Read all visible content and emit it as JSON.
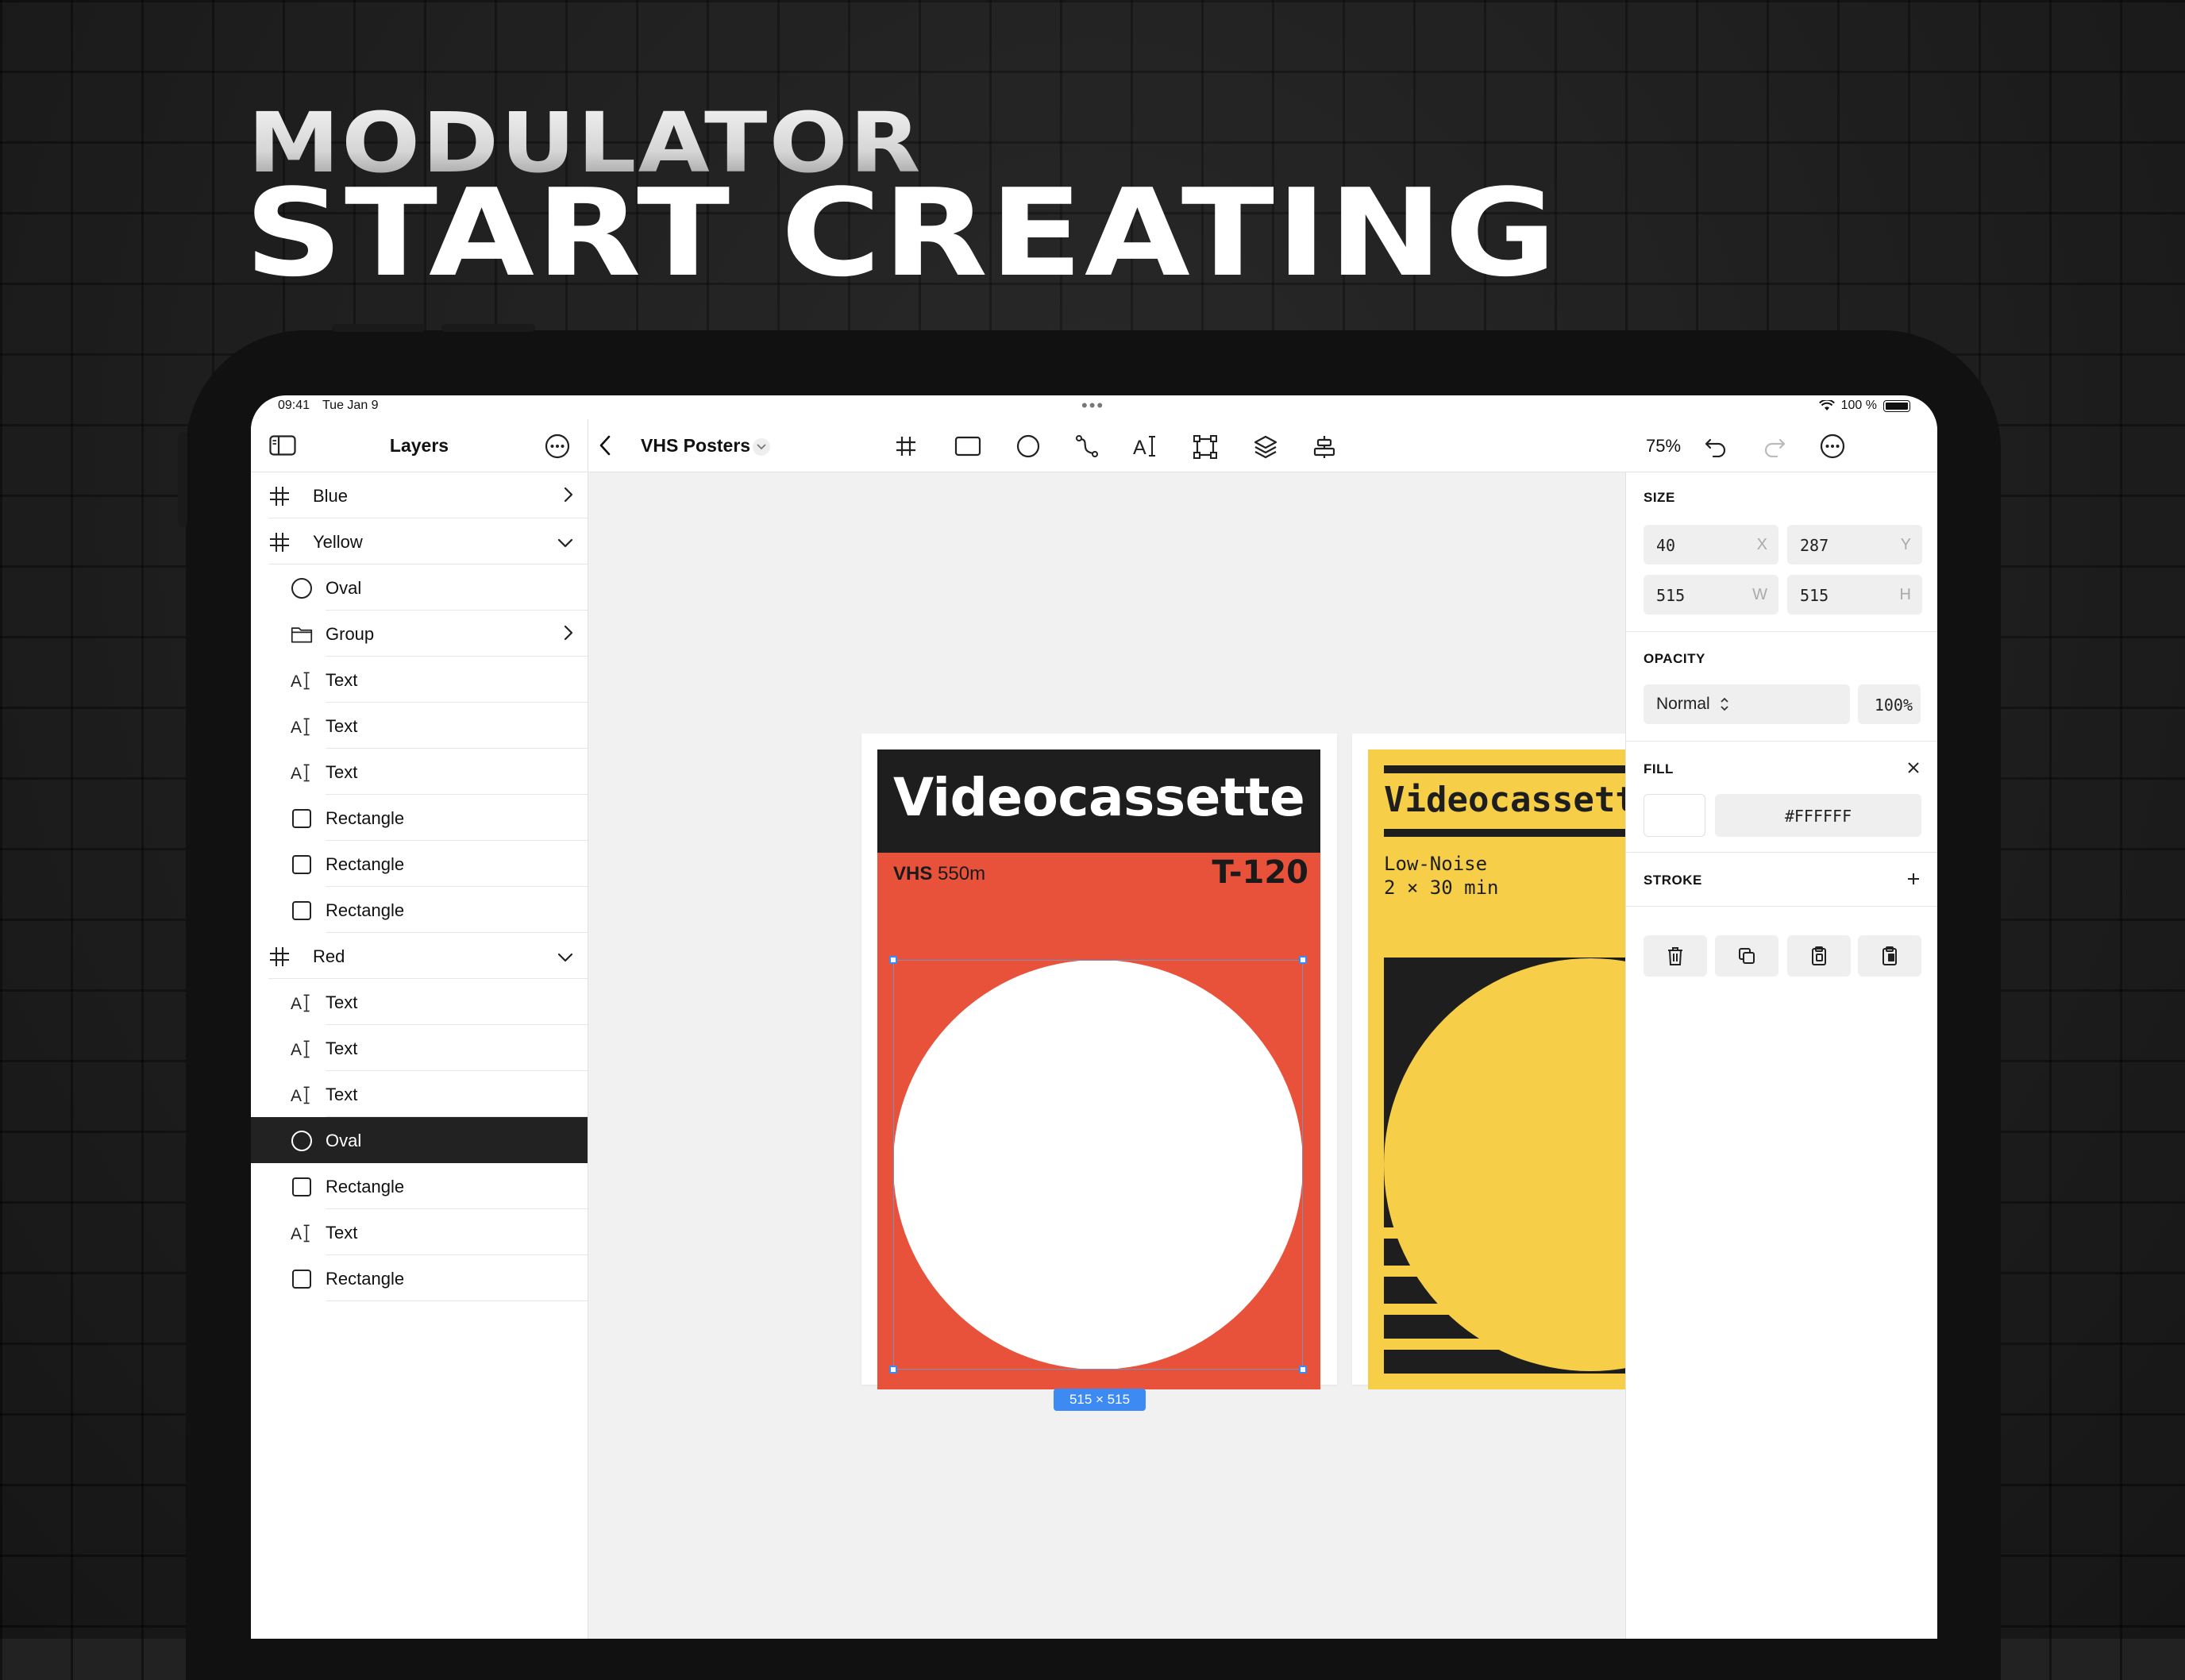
{
  "hero": {
    "subtitle": "MODULATOR",
    "title": "START CREATING"
  },
  "status_bar": {
    "time": "09:41",
    "date": "Tue Jan 9",
    "battery": "100 %"
  },
  "layers_panel": {
    "title": "Layers",
    "items": [
      {
        "label": "Blue",
        "icon": "frame-icon",
        "indent": 0,
        "chevron": "right"
      },
      {
        "label": "Yellow",
        "icon": "frame-icon",
        "indent": 0,
        "chevron": "down"
      },
      {
        "label": "Oval",
        "icon": "oval-icon",
        "indent": 1
      },
      {
        "label": "Group",
        "icon": "folder-icon",
        "indent": 1,
        "chevron": "right"
      },
      {
        "label": "Text",
        "icon": "text-icon",
        "indent": 1
      },
      {
        "label": "Text",
        "icon": "text-icon",
        "indent": 1
      },
      {
        "label": "Text",
        "icon": "text-icon",
        "indent": 1
      },
      {
        "label": "Rectangle",
        "icon": "rectangle-icon",
        "indent": 1
      },
      {
        "label": "Rectangle",
        "icon": "rectangle-icon",
        "indent": 1
      },
      {
        "label": "Rectangle",
        "icon": "rectangle-icon",
        "indent": 1
      },
      {
        "label": "Red",
        "icon": "frame-icon",
        "indent": 0,
        "chevron": "down"
      },
      {
        "label": "Text",
        "icon": "text-icon",
        "indent": 1
      },
      {
        "label": "Text",
        "icon": "text-icon",
        "indent": 1
      },
      {
        "label": "Text",
        "icon": "text-icon",
        "indent": 1
      },
      {
        "label": "Oval",
        "icon": "oval-icon",
        "indent": 1,
        "selected": true
      },
      {
        "label": "Rectangle",
        "icon": "rectangle-icon",
        "indent": 1
      },
      {
        "label": "Text",
        "icon": "text-icon",
        "indent": 1
      },
      {
        "label": "Rectangle",
        "icon": "rectangle-icon",
        "indent": 1
      }
    ]
  },
  "toolbar": {
    "document_title": "VHS Posters",
    "zoom": "75%",
    "tools": [
      "frame-tool-icon",
      "rectangle-tool-icon",
      "oval-tool-icon",
      "pen-tool-icon",
      "text-tool-icon",
      "transform-tool-icon",
      "layers-tool-icon",
      "align-tool-icon"
    ]
  },
  "canvas": {
    "red_poster": {
      "title": "Videocassette",
      "brand": "VHS",
      "length": "550m",
      "model": "T-120",
      "selection_size": "515 × 515"
    },
    "yellow_poster": {
      "title": "Videocassette",
      "line1": "Low-Noise",
      "line2": "2 × 30 min"
    },
    "colors": {
      "red": "#E8513A",
      "black": "#1E1E1E",
      "yellow": "#F6CE47",
      "teal": "#67D3CC",
      "selection": "#3D8BF2"
    }
  },
  "inspector": {
    "size": {
      "title": "SIZE",
      "x": "40",
      "x_unit": "X",
      "y": "287",
      "y_unit": "Y",
      "w": "515",
      "w_unit": "W",
      "h": "515",
      "h_unit": "H"
    },
    "opacity": {
      "title": "OPACITY",
      "blend": "Normal",
      "value": "100%"
    },
    "fill": {
      "title": "FILL",
      "color": "#FFFFFF",
      "hex": "#FFFFFF"
    },
    "stroke": {
      "title": "STROKE"
    }
  }
}
